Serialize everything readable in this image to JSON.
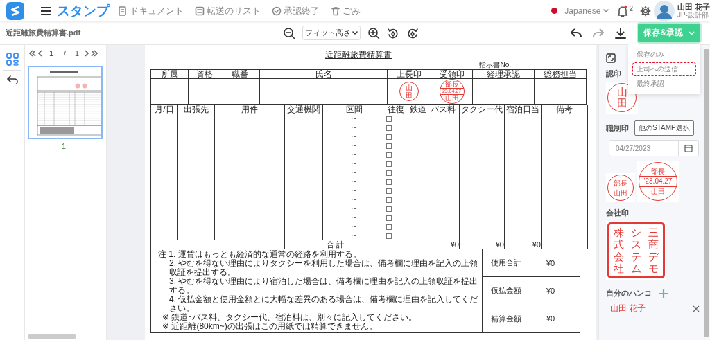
{
  "app": {
    "title": "スタンプ",
    "nav": [
      {
        "label": "ドキュメント"
      },
      {
        "label": "転送のリスト"
      },
      {
        "label": "承認終了"
      },
      {
        "label": "ごみ"
      }
    ],
    "language": "Japanese",
    "notifications": "2",
    "user": {
      "name": "山田 花子",
      "dept": "JP-設計部"
    }
  },
  "toolbar": {
    "filename": "近距離旅費精算書.pdf",
    "zoom": "フィット高さ",
    "save_button": "保存&承認",
    "menu": [
      {
        "label": "保存のみ",
        "highlighted": false
      },
      {
        "label": "上司への送信",
        "highlighted": true
      },
      {
        "label": "最終承認",
        "highlighted": false
      }
    ]
  },
  "pager": {
    "current": "1",
    "separator": "/",
    "total": "1",
    "pages": [
      {
        "label": "1",
        "selected": true
      }
    ]
  },
  "document": {
    "title": "近距離旅費精算書",
    "instruction_no": "指示書No.",
    "approval_headers": [
      {
        "label": "所属"
      },
      {
        "label": "資格"
      },
      {
        "label": "職番"
      },
      {
        "label": "氏名"
      },
      {
        "label": "上長印",
        "stamp": [
          "山田"
        ]
      },
      {
        "label": "受領印",
        "stamp": [
          "部長",
          "23.04.27",
          "山田"
        ]
      },
      {
        "label": "経理承認"
      },
      {
        "label": "総務担当"
      }
    ],
    "columns": [
      "月/日",
      "出張先",
      "用件",
      "交通機関",
      "区間",
      "往復",
      "鉄道･バス料",
      "タクシー代",
      "宿泊日当",
      "備考"
    ],
    "rows": [
      {
        "route": "~",
        "round_trip": false
      },
      {
        "route": "~",
        "round_trip": false
      },
      {
        "route": "~",
        "round_trip": false
      },
      {
        "route": "~",
        "round_trip": false
      },
      {
        "route": "~",
        "round_trip": false
      },
      {
        "route": "~",
        "round_trip": false
      },
      {
        "route": "~",
        "round_trip": false
      },
      {
        "route": "~",
        "round_trip": false
      },
      {
        "route": "~",
        "round_trip": false
      },
      {
        "route": "~",
        "round_trip": false
      },
      {
        "route": "~",
        "round_trip": false
      },
      {
        "route": "~",
        "round_trip": false
      },
      {
        "route": "~",
        "round_trip": false
      },
      {
        "route": "~",
        "round_trip": false
      }
    ],
    "total_label": "合 計",
    "totals": [
      "¥0",
      "¥0",
      "¥0"
    ],
    "notes": [
      "注 1. 運賃はもっとも経済的な通常の経路を利用する。",
      "2. やむを得ない理由によりタクシーを利用した場合は、備考欄に理由を記入の上領収証を提出する。",
      "3. やむを得ない理由により宿泊した場合は、備考欄に理由を記入の上領収証を提出する。",
      "4. 仮払金額と使用金額とに大幅な差異のある場合は、備考欄に理由を記入してください。",
      "※ 鉄道･バス料、タクシー代、宿泊料は、別々に記入してください。",
      "※ 近距離(80km~)の出張はこの用紙では精算できません。"
    ],
    "summary": [
      {
        "label": "使用合計",
        "value": "¥0"
      },
      {
        "label": "仮払金額",
        "value": "¥0"
      },
      {
        "label": "精算金額",
        "value": "¥0"
      }
    ]
  },
  "stamp_panel": {
    "personal_seal": {
      "label": "認印",
      "text": "山田"
    },
    "title_seal": {
      "label": "職制印",
      "button": "他のSTAMP選択",
      "date": "04/27/2023",
      "stamps": [
        {
          "lines": [
            "部長",
            "山田"
          ]
        },
        {
          "lines": [
            "部長",
            "'23.04.27",
            "山田"
          ]
        }
      ]
    },
    "company_seal": {
      "label": "会社印",
      "columns": [
        "株式会社",
        "システム",
        "三商デモ"
      ]
    },
    "my_hanko": {
      "label": "自分のハンコ",
      "items": [
        {
          "name": "山田 花子"
        }
      ]
    }
  }
}
